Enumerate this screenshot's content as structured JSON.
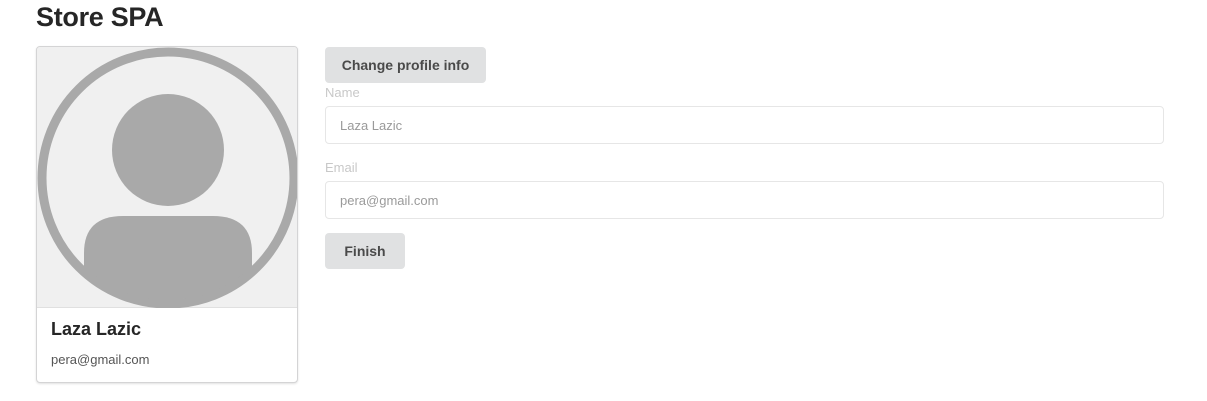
{
  "header": {
    "title": "Store SPA"
  },
  "profile_card": {
    "avatar_icon": "user-avatar-icon",
    "name": "Laza Lazic",
    "email": "pera@gmail.com"
  },
  "form": {
    "change_button_label": "Change profile info",
    "name_label": "Name",
    "name_value": "Laza Lazic",
    "email_label": "Email",
    "email_value": "pera@gmail.com",
    "finish_button_label": "Finish"
  },
  "colors": {
    "avatar_fill": "#a9a9a9",
    "avatar_background": "#f0f0f0",
    "button_background": "#e0e1e2"
  }
}
